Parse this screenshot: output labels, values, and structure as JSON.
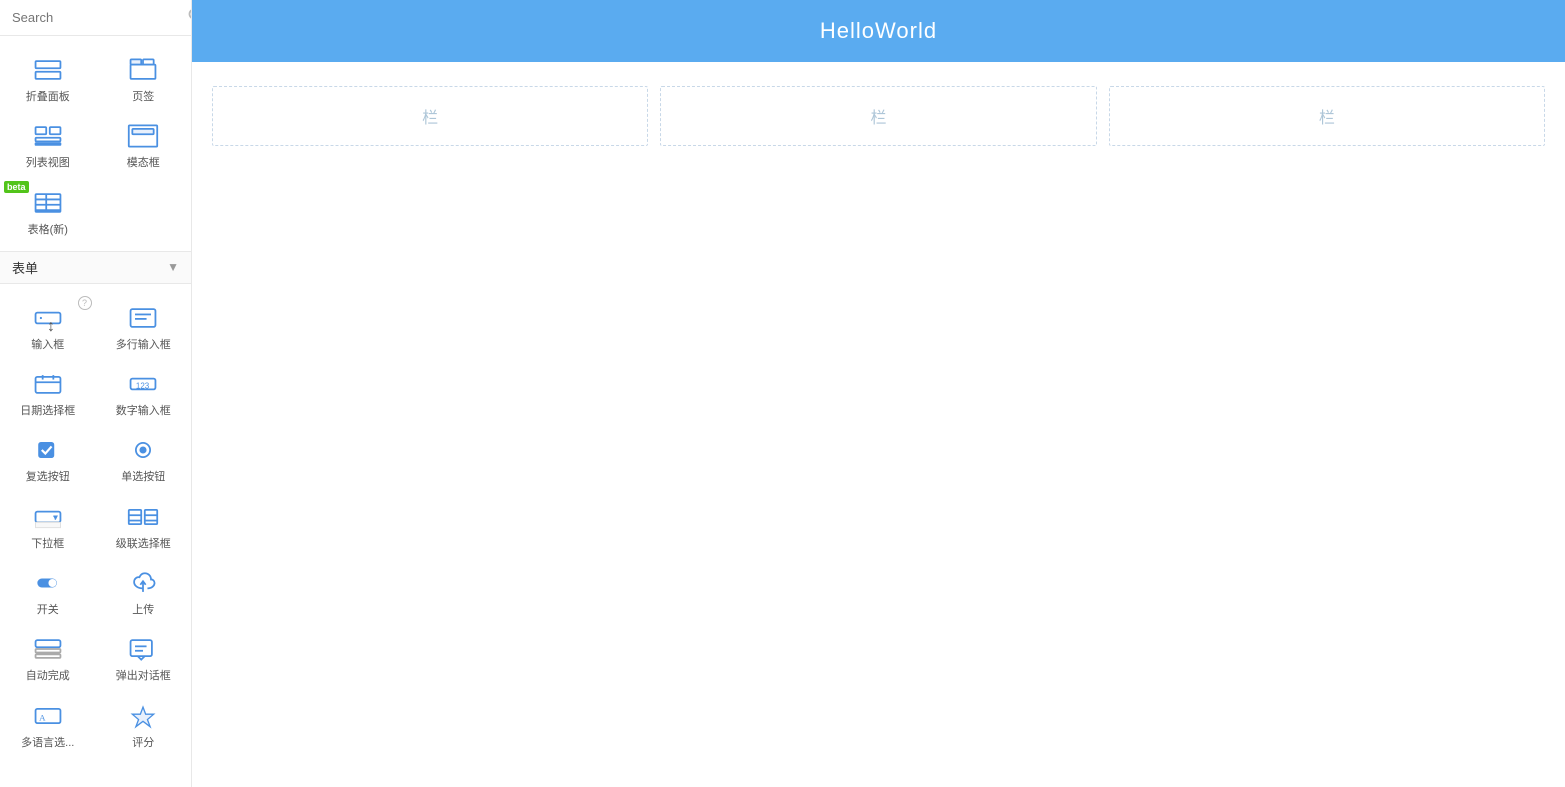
{
  "search": {
    "placeholder": "Search"
  },
  "header": {
    "title": "HelloWorld"
  },
  "canvas": {
    "col_label": "栏",
    "rows": [
      {
        "cols": [
          "栏",
          "栏",
          "栏"
        ]
      }
    ]
  },
  "sidebar": {
    "top_components": [
      {
        "id": "collapse-panel",
        "label": "折叠面板",
        "icon": "collapse"
      },
      {
        "id": "tabs",
        "label": "页签",
        "icon": "tabs"
      },
      {
        "id": "list-view",
        "label": "列表视图",
        "icon": "list"
      },
      {
        "id": "modal",
        "label": "模态框",
        "icon": "modal"
      },
      {
        "id": "table-new",
        "label": "表格(新)",
        "icon": "table-new",
        "beta": true
      }
    ],
    "section_form": {
      "label": "表单",
      "expanded": true
    },
    "form_components": [
      {
        "id": "input",
        "label": "输入框",
        "icon": "input",
        "help": true,
        "cursor": true
      },
      {
        "id": "textarea",
        "label": "多行输入框",
        "icon": "textarea"
      },
      {
        "id": "date-picker",
        "label": "日期选择框",
        "icon": "datepicker"
      },
      {
        "id": "number-input",
        "label": "数字输入框",
        "icon": "numberinput"
      },
      {
        "id": "checkbox",
        "label": "复选按钮",
        "icon": "checkbox"
      },
      {
        "id": "radio",
        "label": "单选按钮",
        "icon": "radio"
      },
      {
        "id": "select",
        "label": "下拉框",
        "icon": "select"
      },
      {
        "id": "cascader",
        "label": "级联选择框",
        "icon": "cascader"
      },
      {
        "id": "switch",
        "label": "开关",
        "icon": "switch"
      },
      {
        "id": "upload",
        "label": "上传",
        "icon": "upload"
      },
      {
        "id": "autocomplete",
        "label": "自动完成",
        "icon": "autocomplete"
      },
      {
        "id": "popup-dialog",
        "label": "弹出对话框",
        "icon": "popup"
      },
      {
        "id": "multilang",
        "label": "多语言选...",
        "icon": "multilang"
      },
      {
        "id": "rating",
        "label": "评分",
        "icon": "rating"
      }
    ]
  }
}
